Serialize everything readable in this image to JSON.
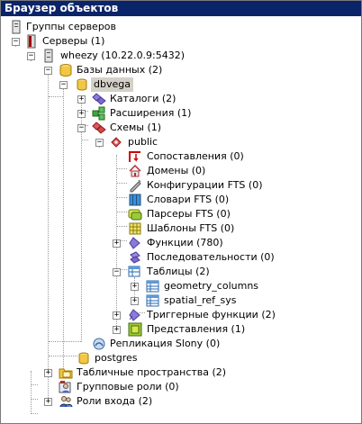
{
  "window": {
    "title": "Браузер объектов"
  },
  "tree": {
    "server_groups": "Группы серверов",
    "servers": "Серверы (1)",
    "server": "wheezy (10.22.0.9:5432)",
    "databases": "Базы данных (2)",
    "db_dbvega": "dbvega",
    "catalogs": "Каталоги (2)",
    "extensions": "Расширения (1)",
    "schemas": "Схемы (1)",
    "schema_public": "public",
    "collations": "Сопоставления (0)",
    "domains": "Домены (0)",
    "fts_configs": "Конфигурации FTS (0)",
    "fts_dicts": "Словари FTS (0)",
    "fts_parsers": "Парсеры FTS (0)",
    "fts_templates": "Шаблоны FTS (0)",
    "functions": "Функции (780)",
    "sequences": "Последовательности (0)",
    "tables": "Таблицы (2)",
    "table_geometry_columns": "geometry_columns",
    "table_spatial_ref_sys": "spatial_ref_sys",
    "trigger_functions": "Триггерные функции (2)",
    "views": "Представления (1)",
    "slony": "Репликация Slony (0)",
    "db_postgres": "postgres",
    "tablespaces": "Табличные пространства (2)",
    "group_roles": "Групповые роли (0)",
    "login_roles": "Роли входа (2)"
  },
  "expander_symbols": {
    "plus": "+",
    "minus": "−"
  }
}
